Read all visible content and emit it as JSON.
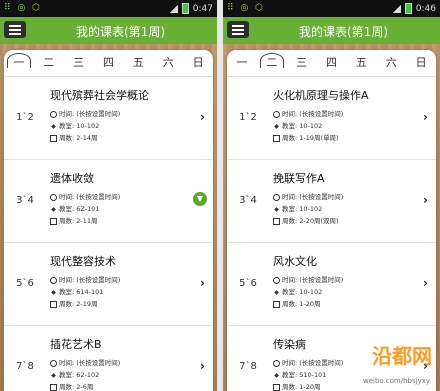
{
  "status_left": "⠿ ◎ ⬡",
  "left": {
    "time": "0:47",
    "title": "我的课表(第1周)",
    "days": [
      "一",
      "二",
      "三",
      "四",
      "五",
      "六",
      "日"
    ],
    "courses": [
      {
        "period": "1`2",
        "name": "现代殡葬社会学概论",
        "time": "时间: (长按设置时间)",
        "room": "教室: 10-102",
        "weeks": "周数: 2-14周",
        "action": "chevron"
      },
      {
        "period": "3`4",
        "name": "遗体收敛",
        "time": "时间: (长按设置时间)",
        "room": "教室: 6Z-101",
        "weeks": "周数: 2-11周",
        "action": "expand"
      },
      {
        "period": "5`6",
        "name": "现代整容技术",
        "time": "时间: (长按设置时间)",
        "room": "教室: 614-101",
        "weeks": "周数: 2-19周",
        "action": "chevron"
      },
      {
        "period": "7`8",
        "name": "插花艺术B",
        "time": "时间: (长按设置时间)",
        "room": "教室: 62-102",
        "weeks": "周数: 2-6周",
        "action": "chevron"
      }
    ]
  },
  "right": {
    "time": "0:46",
    "title": "我的课表(第1周)",
    "days": [
      "一",
      "二",
      "三",
      "四",
      "五",
      "六",
      "日"
    ],
    "courses": [
      {
        "period": "1`2",
        "name": "火化机原理与操作A",
        "time": "时间: (长按设置时间)",
        "room": "教室: 10-102",
        "weeks": "周数: 1-19周(单周)",
        "action": "chevron"
      },
      {
        "period": "3`4",
        "name": "挽联写作A",
        "time": "时间: (长按设置时间)",
        "room": "教室: 10-102",
        "weeks": "周数: 2-20周(双周)",
        "action": "chevron"
      },
      {
        "period": "5`6",
        "name": "风水文化",
        "time": "时间: (长按设置时间)",
        "room": "教室: 10-102",
        "weeks": "周数: 1-20周",
        "action": "chevron"
      },
      {
        "period": "7`8",
        "name": "传染病",
        "time": "时间: (长按设置时间)",
        "room": "教室: S10-101",
        "weeks": "周数: 1-20周",
        "action": "chevron"
      }
    ]
  },
  "watermark": "沿都网",
  "watermark_url": "weibo.com/hbsjyxy"
}
